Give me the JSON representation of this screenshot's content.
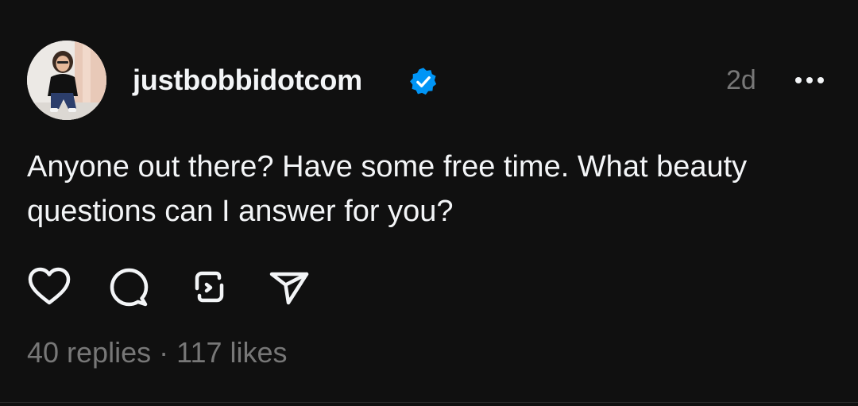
{
  "post": {
    "username": "justbobbidotcom",
    "verified": true,
    "timestamp": "2d",
    "text": "Anyone out there? Have some free time. What beauty questions can I answer for you?",
    "replies_label": "40 replies",
    "separator": "·",
    "likes_label": "117 likes"
  },
  "icons": {
    "verified": "verified-badge-icon",
    "more": "more-horizontal-icon",
    "like": "heart-outline-icon",
    "reply": "comment-bubble-icon",
    "repost": "repost-icon",
    "share": "send-paper-plane-icon"
  },
  "colors": {
    "background": "#101010",
    "text_primary": "#f3f5f7",
    "text_secondary": "#777777",
    "verified_blue": "#0095f6"
  }
}
